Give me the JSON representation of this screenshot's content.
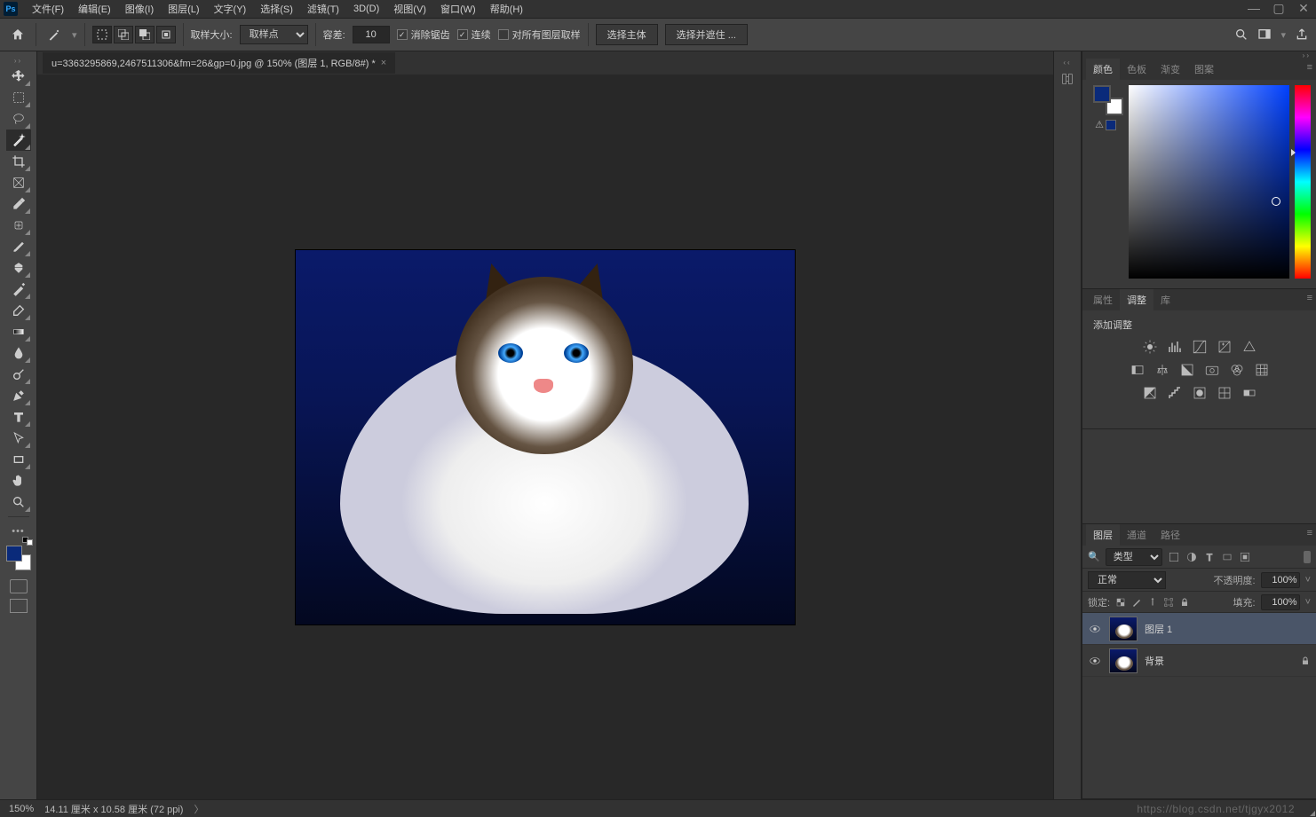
{
  "app": {
    "logo": "Ps"
  },
  "menu": {
    "file": "文件(F)",
    "edit": "编辑(E)",
    "image": "图像(I)",
    "layer": "图层(L)",
    "type": "文字(Y)",
    "select": "选择(S)",
    "filter": "滤镜(T)",
    "threed": "3D(D)",
    "view": "视图(V)",
    "window": "窗口(W)",
    "help": "帮助(H)"
  },
  "options": {
    "sample_size_label": "取样大小:",
    "sample_size_value": "取样点",
    "tolerance_label": "容差:",
    "tolerance_value": "10",
    "antialias": "消除锯齿",
    "contiguous": "连续",
    "sample_all_layers": "对所有图层取样",
    "select_subject": "选择主体",
    "select_and_mask": "选择并遮住 ..."
  },
  "document": {
    "tab_title": "u=3363295869,2467511306&fm=26&gp=0.jpg @ 150% (图层 1, RGB/8#) *"
  },
  "panels": {
    "color": {
      "tab_color": "颜色",
      "tab_swatches": "色板",
      "tab_gradient": "渐变",
      "tab_pattern": "图案"
    },
    "adjust": {
      "tab_props": "属性",
      "tab_adjust": "调整",
      "tab_lib": "库",
      "title": "添加调整"
    },
    "layers": {
      "tab_layers": "图层",
      "tab_channels": "通道",
      "tab_paths": "路径",
      "filter_label": "类型",
      "blend_mode": "正常",
      "opacity_label": "不透明度:",
      "opacity_value": "100%",
      "lock_label": "锁定:",
      "fill_label": "填充:",
      "fill_value": "100%",
      "items": [
        {
          "name": "图层 1",
          "locked": false
        },
        {
          "name": "背景",
          "locked": true
        }
      ]
    }
  },
  "status": {
    "zoom": "150%",
    "info": "14.11 厘米 x 10.58 厘米 (72 ppi)"
  },
  "watermark": "https://blog.csdn.net/tjgyx2012"
}
